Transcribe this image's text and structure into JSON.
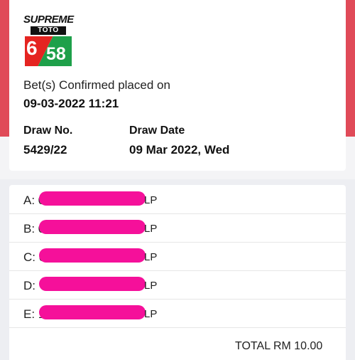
{
  "logo": {
    "brand": "SUPREME",
    "sub": "TOTO",
    "number_left": "6",
    "number_right": "58"
  },
  "confirmation": {
    "label": "Bet(s) Confirmed placed on",
    "datetime": "09-03-2022 11:21"
  },
  "draw": {
    "no_label": "Draw No.",
    "no_value": "5429/22",
    "date_label": "Draw Date",
    "date_value": "09 Mar 2022, Wed"
  },
  "bets": [
    {
      "label": "A: 0",
      "suffix": "LP"
    },
    {
      "label": "B: 0",
      "suffix": "LP"
    },
    {
      "label": "C: 0",
      "suffix": "LP"
    },
    {
      "label": "D:",
      "suffix": "LP"
    },
    {
      "label": "E: 1",
      "suffix": "LP"
    }
  ],
  "total": "TOTAL RM 10.00",
  "colors": {
    "header_red": "#e04a58",
    "redaction_pink": "#f5109a",
    "logo_red": "#e52421",
    "logo_green": "#1ea04a"
  }
}
